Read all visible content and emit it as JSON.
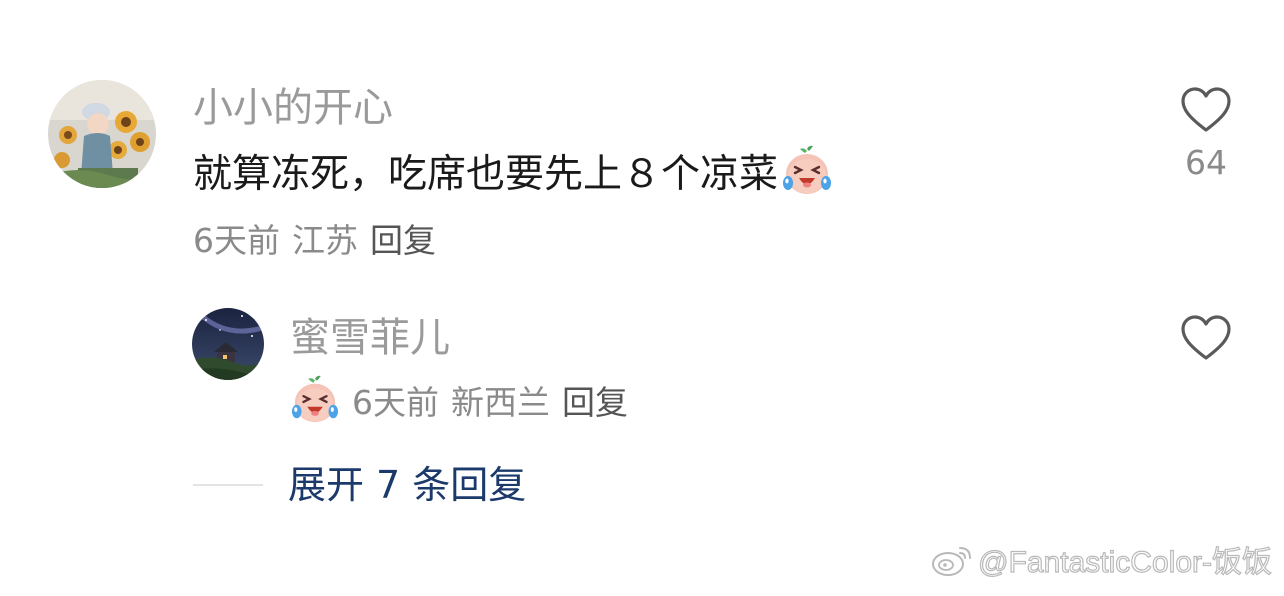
{
  "comment": {
    "username": "小小的开心",
    "text": "就算冻死，吃席也要先上８个凉菜",
    "emoji": "crying-laughing-peach-emoji",
    "time": "6天前",
    "location": "江苏",
    "reply_label": "回复",
    "like_count": "64",
    "like_icon": "heart-outline-icon"
  },
  "reply": {
    "username": "蜜雪菲儿",
    "emoji": "crying-laughing-peach-emoji",
    "time": "6天前",
    "location": "新西兰",
    "reply_label": "回复",
    "like_icon": "heart-outline-icon"
  },
  "expand": {
    "prefix": "展开",
    "count": "7",
    "suffix": "条回复"
  },
  "watermark": {
    "text": "@FantasticColor-饭饭",
    "icon": "weibo-logo-icon"
  },
  "colors": {
    "username": "#9a9a9a",
    "comment_text": "#1a1a1a",
    "meta": "#8a8a8a",
    "expand_link": "#1b3a6b",
    "background": "#ffffff"
  }
}
